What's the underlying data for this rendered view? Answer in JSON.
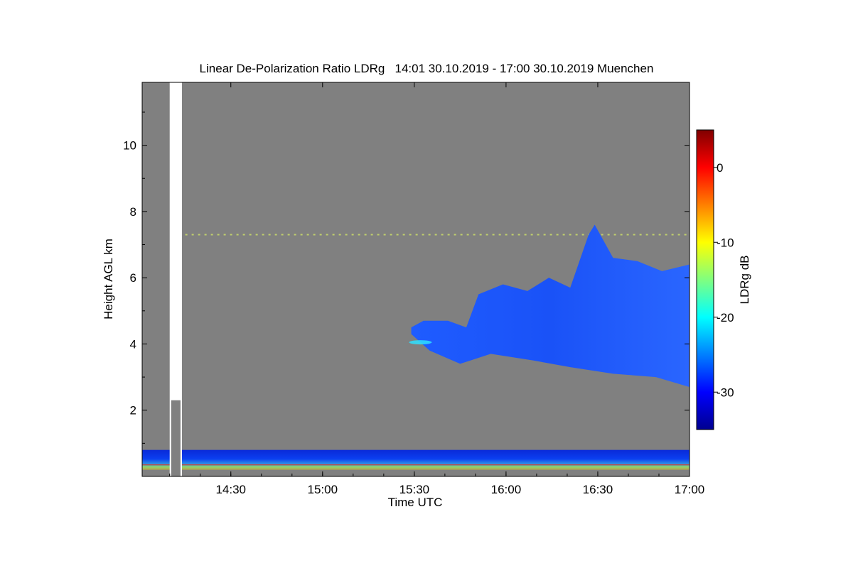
{
  "chart_data": {
    "type": "heatmap",
    "title": "Linear De-Polarization Ratio LDRg   14:01 30.10.2019 - 17:00 30.10.2019 Muenchen",
    "xlabel": "Time UTC",
    "ylabel": "Height AGL km",
    "xlim": [
      "14:01",
      "17:00"
    ],
    "ylim_km": [
      0,
      11.9
    ],
    "x_ticks": [
      "14:30",
      "15:00",
      "15:30",
      "16:00",
      "16:30",
      "17:00"
    ],
    "x_tick_minutes": [
      29,
      59,
      89,
      119,
      149,
      179
    ],
    "y_ticks": [
      2,
      4,
      6,
      8,
      10
    ],
    "colorbar": {
      "label": "LDRg dB",
      "range_db": [
        -35,
        5
      ],
      "ticks": [
        0,
        -10,
        -20,
        -30
      ],
      "colormap": "jet"
    },
    "background_color": "#808080",
    "features": [
      {
        "name": "boundary-layer",
        "time_range": [
          "14:01",
          "17:00"
        ],
        "height_km": [
          0.2,
          0.8
        ],
        "ldr_db_typical": -28
      },
      {
        "name": "cirrus-cloud",
        "time_range": [
          "15:29",
          "17:00"
        ],
        "height_km": [
          2.7,
          7.6
        ],
        "ldr_db_typical": -28
      },
      {
        "name": "thin-layer",
        "time_range": [
          "14:01",
          "17:00"
        ],
        "height_km": [
          7.25,
          7.35
        ],
        "ldr_db_typical": -18
      }
    ],
    "data_gaps": [
      {
        "time_range": [
          "14:10",
          "14:14"
        ]
      }
    ]
  }
}
